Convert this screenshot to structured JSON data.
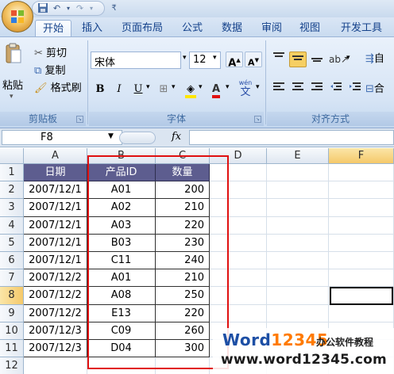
{
  "tabs": [
    "开始",
    "插入",
    "页面布局",
    "公式",
    "数据",
    "审阅",
    "视图",
    "开发工具"
  ],
  "active_tab": "开始",
  "clipboard": {
    "cut": "剪切",
    "copy": "复制",
    "format_painter": "格式刷",
    "paste": "粘贴",
    "group_label": "剪贴板"
  },
  "font": {
    "name": "宋体",
    "size": "12",
    "bold": "B",
    "italic": "I",
    "underline": "U",
    "grow": "A",
    "shrink": "A",
    "color_a": "A",
    "wen": "wén",
    "group_label": "字体"
  },
  "alignment": {
    "group_label": "对齐方式",
    "wrap": "自",
    "merge": "合"
  },
  "formula_bar": {
    "name_box": "F8",
    "fx": "fx",
    "value": ""
  },
  "columns": [
    "A",
    "B",
    "C",
    "D",
    "E",
    "F"
  ],
  "rows": [
    "1",
    "2",
    "3",
    "4",
    "5",
    "6",
    "7",
    "8",
    "9",
    "10",
    "11",
    "12"
  ],
  "table": {
    "headers": [
      "日期",
      "产品ID",
      "数量"
    ],
    "rows": [
      [
        "2007/12/1",
        "A01",
        "200"
      ],
      [
        "2007/12/1",
        "A02",
        "210"
      ],
      [
        "2007/12/1",
        "A03",
        "220"
      ],
      [
        "2007/12/1",
        "B03",
        "230"
      ],
      [
        "2007/12/1",
        "C11",
        "240"
      ],
      [
        "2007/12/2",
        "A01",
        "210"
      ],
      [
        "2007/12/2",
        "A08",
        "250"
      ],
      [
        "2007/12/2",
        "E13",
        "220"
      ],
      [
        "2007/12/3",
        "C09",
        "260"
      ],
      [
        "2007/12/3",
        "D04",
        "300"
      ]
    ]
  },
  "watermark": {
    "brand_word": "Word",
    "brand_num": "12345",
    "cn": "办公软件教程",
    "url": "www.word12345.com"
  },
  "colors": {
    "header_fill": "#5d5d8f",
    "highlight": "#e01010",
    "ribbon_text": "#15428b"
  }
}
